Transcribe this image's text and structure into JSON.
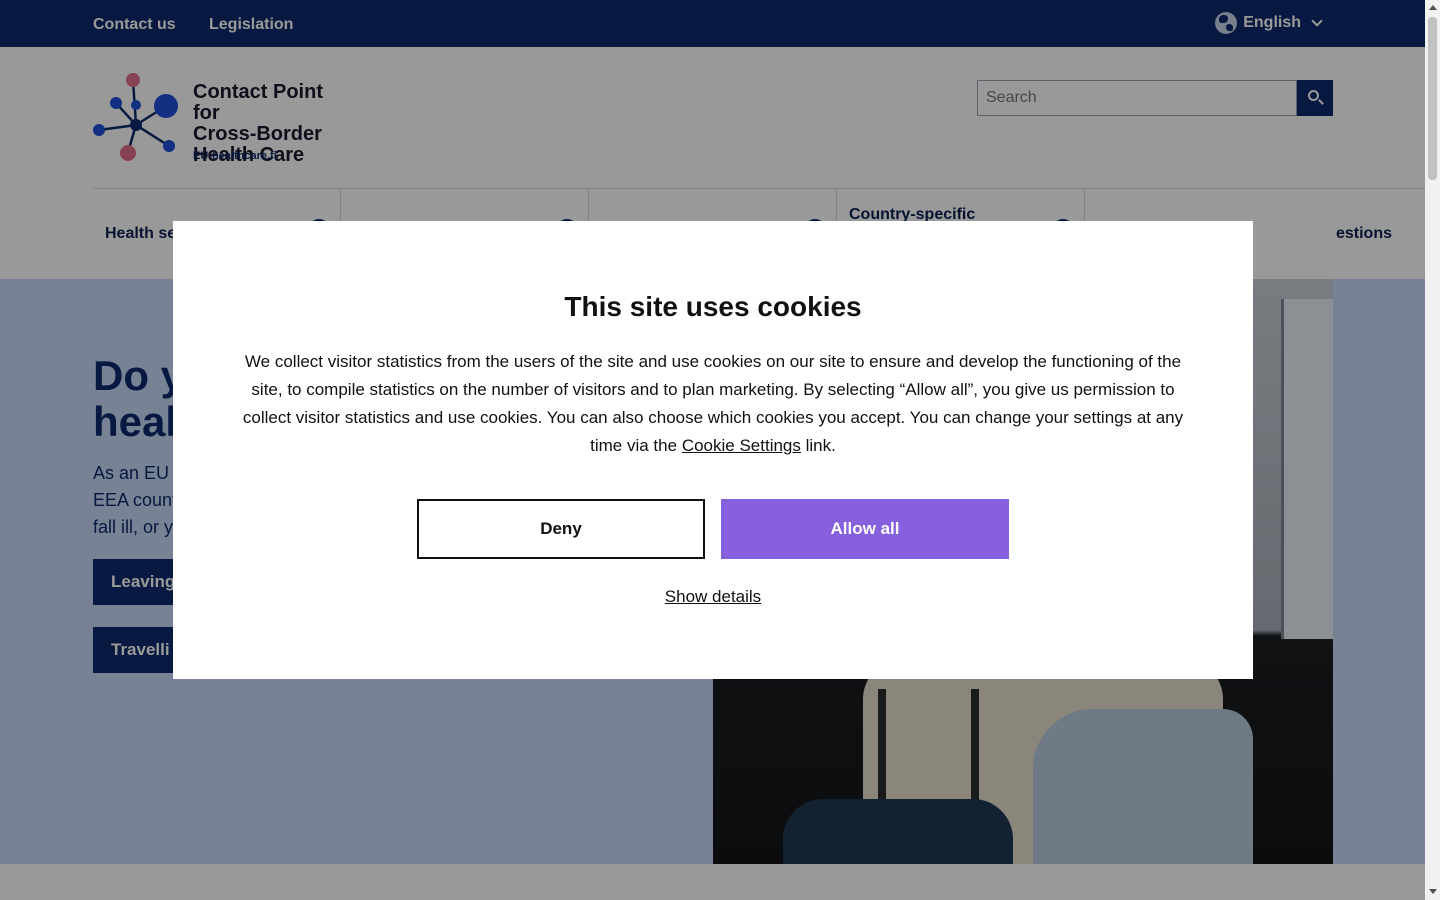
{
  "topbar": {
    "links": [
      "Contact us",
      "Legislation"
    ],
    "language": "English",
    "language_icon": "globe-icon"
  },
  "header": {
    "logo_lines": [
      "Contact Point for",
      "Cross-Border",
      "Health Care"
    ],
    "logo_subtitle": "EU-healthcare.fi",
    "search_placeholder": "Search"
  },
  "nav": {
    "items": [
      "Health se",
      "",
      "",
      "Country-specific",
      "estions"
    ]
  },
  "hero": {
    "title_lines": [
      "Do y",
      "heal"
    ],
    "body_lines": [
      "As an EU c",
      "EEA count",
      "fall ill, or y"
    ],
    "buttons": [
      "Leaving",
      "Travelli"
    ]
  },
  "cookie_modal": {
    "title": "This site uses cookies",
    "body_before_link": "We collect visitor statistics from the users of the site and use cookies on our site to ensure and develop the functioning of the site, to compile statistics on the number of visitors and to plan marketing. By selecting “Allow all”, you give us permission to collect visitor statistics and use cookies. You can also choose which cookies you accept. You can change your settings at any time via the",
    "link_text": "Cookie Settings",
    "body_after_link": "link.",
    "deny_label": "Deny",
    "allow_label": "Allow all",
    "details_label": "Show details",
    "colors": {
      "allow": "#8660dd",
      "deny_border": "#111111"
    }
  },
  "colors": {
    "brand_navy": "#0d2a6b",
    "hero_bg": "#c7daf9"
  }
}
